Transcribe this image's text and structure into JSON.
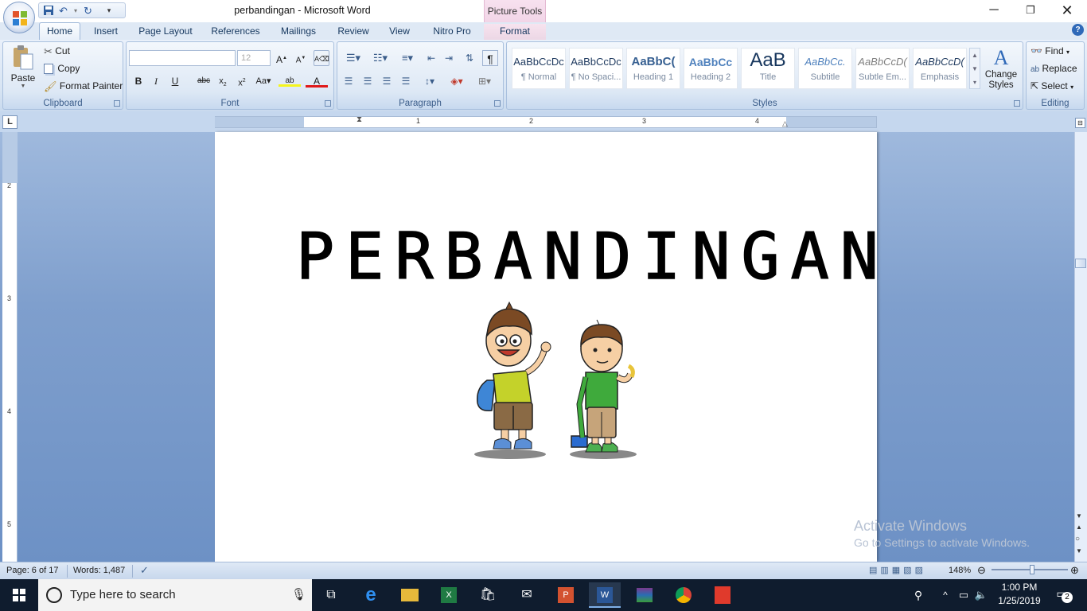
{
  "window": {
    "title": "perbandingan - Microsoft Word",
    "context_tab": "Picture Tools"
  },
  "tabs": [
    {
      "label": "Home",
      "active": true
    },
    {
      "label": "Insert"
    },
    {
      "label": "Page Layout"
    },
    {
      "label": "References"
    },
    {
      "label": "Mailings"
    },
    {
      "label": "Review"
    },
    {
      "label": "View"
    },
    {
      "label": "Nitro Pro"
    },
    {
      "label": "Format"
    }
  ],
  "clipboard": {
    "paste": "Paste",
    "cut": "Cut",
    "copy": "Copy",
    "format_painter": "Format Painter",
    "label": "Clipboard"
  },
  "font": {
    "name": "",
    "size": "12",
    "label": "Font"
  },
  "paragraph": {
    "label": "Paragraph"
  },
  "styles": {
    "label": "Styles",
    "items": [
      {
        "preview": "AaBbCcDc",
        "name": "¶ Normal"
      },
      {
        "preview": "AaBbCcDc",
        "name": "¶ No Spaci..."
      },
      {
        "preview": "AaBbC(",
        "name": "Heading 1"
      },
      {
        "preview": "AaBbCc",
        "name": "Heading 2"
      },
      {
        "preview": "AaB",
        "name": "Title"
      },
      {
        "preview": "AaBbCc.",
        "name": "Subtitle"
      },
      {
        "preview": "AaBbCcD(",
        "name": "Subtle Em..."
      },
      {
        "preview": "AaBbCcD(",
        "name": "Emphasis"
      }
    ],
    "change_styles": "Change Styles"
  },
  "editing": {
    "find": "Find",
    "replace": "Replace",
    "select": "Select",
    "label": "Editing"
  },
  "ruler": {
    "numbers": [
      "1",
      "2",
      "3",
      "4",
      "5"
    ],
    "vnumbers": [
      "2",
      "3",
      "4",
      "5"
    ]
  },
  "document": {
    "heading": "PERBANDINGAN"
  },
  "watermark": {
    "line1": "Activate Windows",
    "line2": "Go to Settings to activate Windows."
  },
  "status": {
    "page": "Page: 6 of 17",
    "words": "Words: 1,487",
    "zoom": "148%"
  },
  "taskbar": {
    "search_placeholder": "Type here to search",
    "time": "1:00 PM",
    "date": "1/25/2019",
    "notifications": "2"
  }
}
